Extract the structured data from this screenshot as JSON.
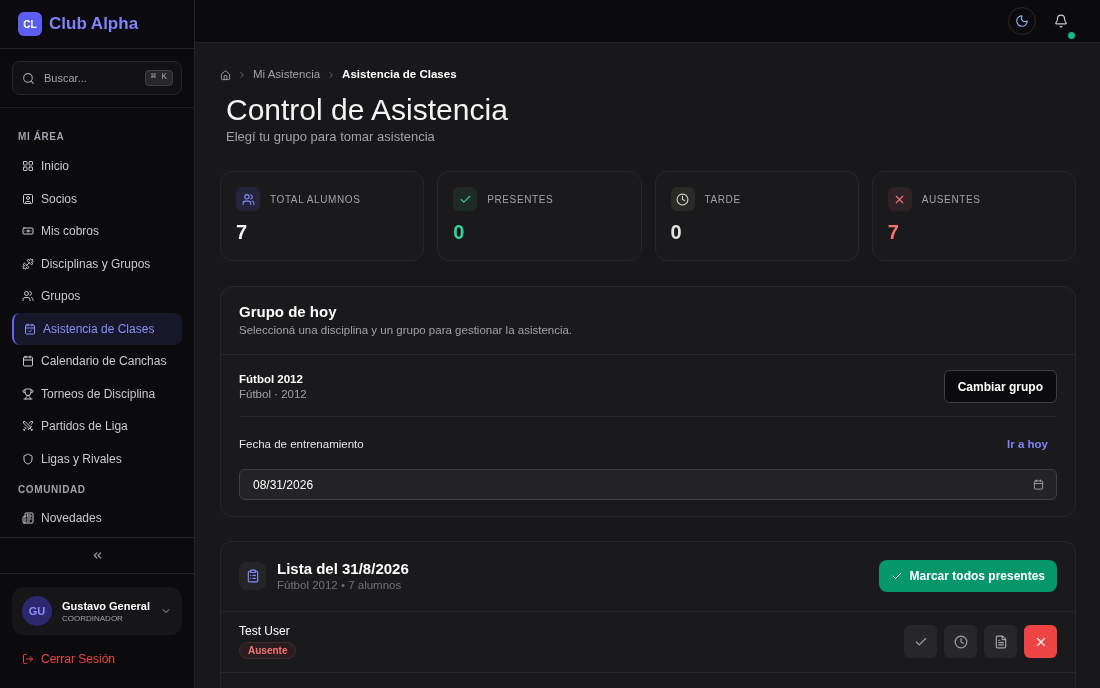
{
  "sidebar": {
    "brand": {
      "logo": "CL",
      "name": "Club Alpha"
    },
    "search": {
      "placeholder": "Buscar...",
      "shortcut": "⌘ K"
    },
    "sections": [
      {
        "title": "MI ÁREA",
        "items": [
          {
            "label": "Inicio",
            "selected": false
          },
          {
            "label": "Socios",
            "selected": false
          },
          {
            "label": "Mis cobros",
            "selected": false
          },
          {
            "label": "Disciplinas y Grupos",
            "selected": false
          },
          {
            "label": "Grupos",
            "selected": false
          },
          {
            "label": "Asistencia de Clases",
            "selected": true
          },
          {
            "label": "Calendario de Canchas",
            "selected": false
          },
          {
            "label": "Torneos de Disciplina",
            "selected": false
          },
          {
            "label": "Partidos de Liga",
            "selected": false
          },
          {
            "label": "Ligas y Rivales",
            "selected": false
          }
        ]
      },
      {
        "title": "COMUNIDAD",
        "items": [
          {
            "label": "Novedades",
            "selected": false
          }
        ]
      }
    ],
    "user": {
      "initials": "GU",
      "name": "Gustavo General",
      "role": "COORDINADOR"
    },
    "logout": "Cerrar Sesión"
  },
  "header": {
    "bell": {
      "unread": true
    }
  },
  "breadcrumb": [
    {
      "label": "Mi Asistencia",
      "current": false
    },
    {
      "label": "Asistencia de Clases",
      "current": true
    }
  ],
  "page": {
    "title": "Control de Asistencia",
    "subtitle": "Elegí tu grupo para tomar asistencia"
  },
  "stats": [
    {
      "kind": "total",
      "label": "TOTAL ALUMNOS",
      "value": "7"
    },
    {
      "kind": "present",
      "label": "PRESENTES",
      "value": "0"
    },
    {
      "kind": "late",
      "label": "TARDE",
      "value": "0"
    },
    {
      "kind": "absent",
      "label": "AUSENTES",
      "value": "7"
    }
  ],
  "group_card": {
    "title": "Grupo de hoy",
    "subtitle": "Seleccioná una disciplina y un grupo para gestionar la asistencia.",
    "group": {
      "name": "Fútbol 2012",
      "detail": "Fútbol · 2012"
    },
    "change_button": "Cambiar grupo",
    "date_label": "Fecha de entrenamiento",
    "today_link": "Ir a hoy",
    "date_value": "08/31/2026"
  },
  "attendance_list": {
    "title": "Lista del 31/8/2026",
    "subtitle": "Fútbol 2012 • 7 alumnos",
    "mark_all_button": "Marcar todos presentes",
    "rows": [
      {
        "name": "Test User",
        "status": "Ausente",
        "actions": [
          {
            "kind": "present",
            "selected": false
          },
          {
            "kind": "late",
            "selected": false
          },
          {
            "kind": "justified",
            "selected": false
          },
          {
            "kind": "absent",
            "selected": true
          }
        ]
      }
    ]
  }
}
